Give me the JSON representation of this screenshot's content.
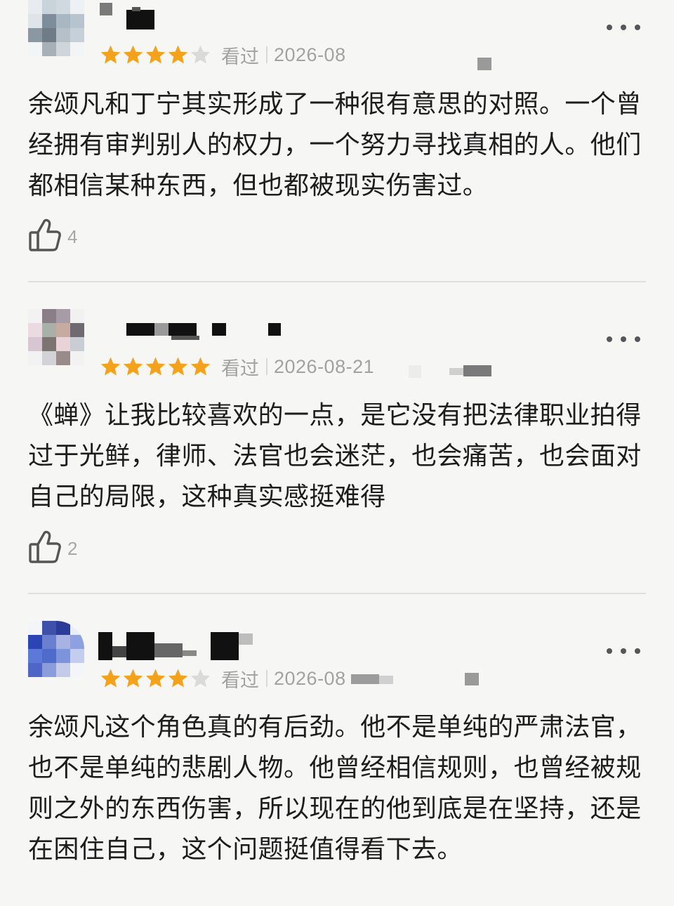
{
  "theme": {
    "star_filled": "#f4a21c",
    "star_empty": "#dadada",
    "meta_text": "#a2a2a2",
    "body_text": "#1d1d1d",
    "background": "#f6f6f4"
  },
  "icons": {
    "more": "more-horizontal-icon",
    "like": "thumbs-up-icon",
    "star": "star-icon"
  },
  "reviews": [
    {
      "username": "",
      "rating": 4,
      "rating_max": 5,
      "watched_label": "看过",
      "date": "2026-08",
      "content": "余颂凡和丁宁其实形成了一种很有意思的对照。一个曾经拥有审判别人的权力，一个努力寻找真相的人。他们都相信某种东西，但也都被现实伤害过。",
      "likes": "4"
    },
    {
      "username": "",
      "rating": 5,
      "rating_max": 5,
      "watched_label": "看过",
      "date": "2026-08-21",
      "content": "《蝉》让我比较喜欢的一点，是它没有把法律职业拍得过于光鲜，律师、法官也会迷茫，也会痛苦，也会面对自己的局限，这种真实感挺难得",
      "likes": "2"
    },
    {
      "username": "",
      "rating": 4,
      "rating_max": 5,
      "watched_label": "看过",
      "date": "2026-08",
      "content": "余颂凡这个角色真的有后劲。他不是单纯的严肃法官，也不是单纯的悲剧人物。他曾经相信规则，也曾经被规则之外的东西伤害，所以现在的他到底是在坚持，还是在困住自己，这个问题挺值得看下去。",
      "likes": ""
    }
  ]
}
